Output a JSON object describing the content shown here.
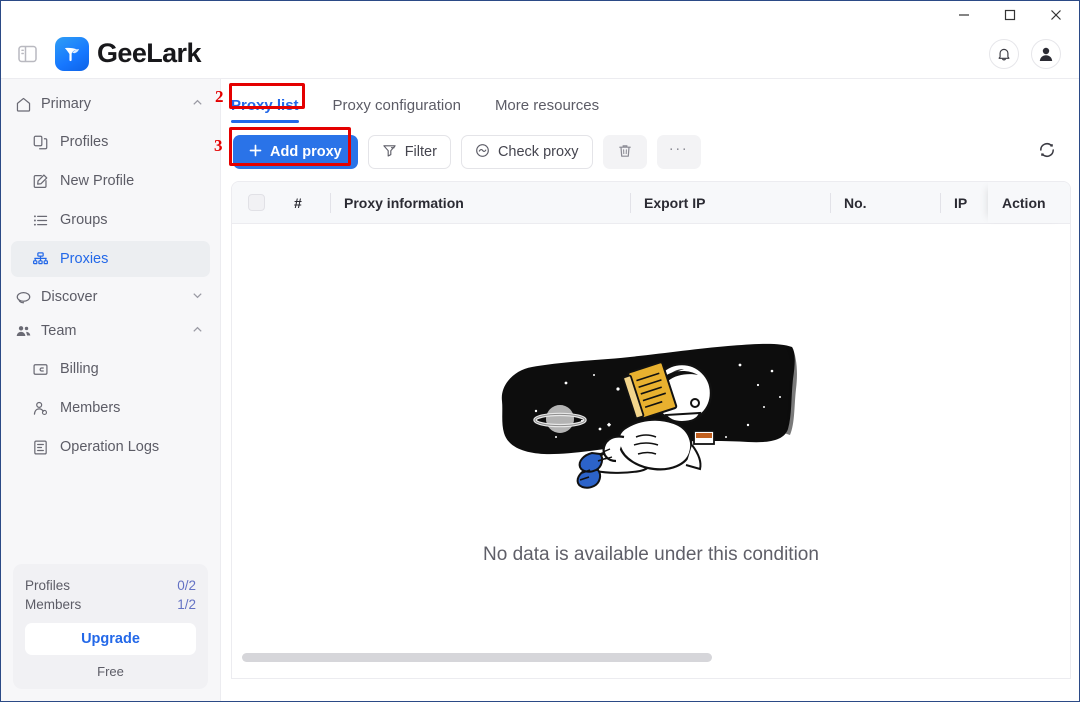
{
  "window": {
    "controls": [
      {
        "name": "minimize",
        "glyph": "minimize-icon"
      },
      {
        "name": "maximize",
        "glyph": "maximize-icon"
      },
      {
        "name": "close",
        "glyph": "close-icon"
      }
    ]
  },
  "header": {
    "panel_toggle_icon": "sidebar-toggle-icon",
    "brand_name": "GeeLark",
    "notification_icon": "bell-icon",
    "account_icon": "user-avatar-icon"
  },
  "sidebar": {
    "groups": [
      {
        "label": "Primary",
        "icon": "home-icon",
        "expanded": true,
        "chevron": "chevron-up-icon",
        "items": [
          {
            "label": "Profiles",
            "icon": "profiles-icon",
            "active": false
          },
          {
            "label": "New Profile",
            "icon": "new-profile-icon",
            "active": false
          },
          {
            "label": "Groups",
            "icon": "groups-list-icon",
            "active": false
          },
          {
            "label": "Proxies",
            "icon": "proxies-network-icon",
            "active": true
          }
        ]
      },
      {
        "label": "Discover",
        "icon": "discover-icon",
        "expanded": false,
        "chevron": "chevron-down-icon",
        "items": []
      },
      {
        "label": "Team",
        "icon": "team-icon",
        "expanded": true,
        "chevron": "chevron-up-icon",
        "items": [
          {
            "label": "Billing",
            "icon": "billing-card-icon",
            "active": false
          },
          {
            "label": "Members",
            "icon": "member-icon",
            "active": false
          },
          {
            "label": "Operation Logs",
            "icon": "logs-icon",
            "active": false
          }
        ]
      }
    ],
    "plan": {
      "rows": [
        {
          "label": "Profiles",
          "value": "0/2"
        },
        {
          "label": "Members",
          "value": "1/2"
        }
      ],
      "upgrade_label": "Upgrade",
      "plan_name": "Free"
    }
  },
  "main": {
    "tabs": [
      {
        "label": "Proxy list",
        "active": true
      },
      {
        "label": "Proxy configuration",
        "active": false
      },
      {
        "label": "More resources",
        "active": false
      }
    ],
    "toolbar": {
      "add_proxy_label": "Add proxy",
      "add_proxy_icon": "plus-icon",
      "filter_label": "Filter",
      "filter_icon": "filter-icon",
      "check_proxy_label": "Check proxy",
      "check_proxy_icon": "check-circle-icon",
      "delete_icon": "trash-icon",
      "more_label": "···",
      "more_icon": "more-horizontal-icon",
      "refresh_icon": "refresh-icon"
    },
    "table": {
      "columns": [
        {
          "key": "select",
          "label": ""
        },
        {
          "key": "num",
          "label": "#"
        },
        {
          "key": "proxy_information",
          "label": "Proxy information"
        },
        {
          "key": "export_ip",
          "label": "Export IP"
        },
        {
          "key": "no",
          "label": "No."
        },
        {
          "key": "ip",
          "label": "IP"
        },
        {
          "key": "action",
          "label": "Action"
        }
      ],
      "rows": [],
      "empty_message": "No data is available under this condition",
      "empty_illustration": "astronaut-reading-in-space-illustration"
    }
  },
  "annotations": [
    {
      "number": "2",
      "target": "proxy-list-tab"
    },
    {
      "number": "3",
      "target": "add-proxy-button"
    }
  ],
  "colors": {
    "accent_blue": "#2368e8",
    "primary_button": "#2a73e8",
    "annotation_red": "#e40000",
    "sidebar_bg": "#f7f7f9",
    "table_header_bg": "#f7f8fa"
  }
}
